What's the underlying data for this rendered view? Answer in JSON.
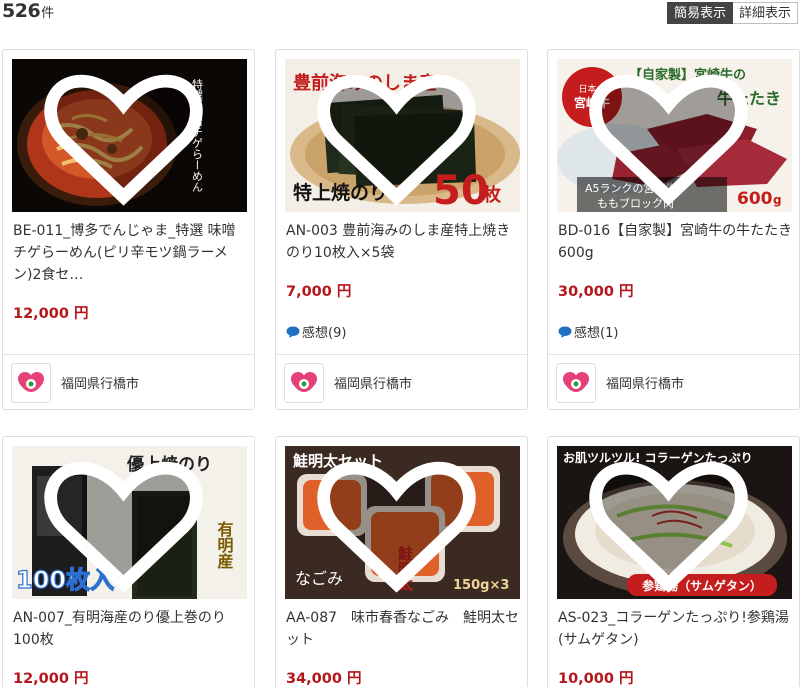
{
  "results": {
    "count": "526",
    "unit": "件"
  },
  "view_toggle": {
    "simple": "簡易表示",
    "detail": "詳細表示"
  },
  "products": [
    {
      "title": "BE-011_博多でんじゃま_特選 味噌チゲらーめん(ピリ辛モツ鍋ラーメン)2食セ…",
      "price": "12,000 円",
      "review": "",
      "city": "福岡県行橋市",
      "photo_text": "特選 味噌チゲらーめん"
    },
    {
      "title": "AN-003 豊前海みのしま産特上焼きのり10枚入×5袋",
      "price": "7,000 円",
      "review": "感想(9)",
      "city": "福岡県行橋市",
      "photo_text_1": "豊前海みのしま産",
      "photo_text_2": "特上焼のり",
      "photo_text_3": "50",
      "photo_text_4": "枚"
    },
    {
      "title": "BD-016【自家製】宮崎牛の牛たたき600g",
      "price": "30,000 円",
      "review": "感想(1)",
      "city": "福岡県行橋市",
      "photo_text_1": "【自家製】宮崎牛の",
      "photo_text_2": "牛たたき",
      "photo_text_3": "日本一",
      "photo_text_4": "宮崎牛",
      "photo_text_5": "A5ランクの宮崎牛",
      "photo_text_6": "ももブロック肉",
      "photo_text_7": "600",
      "photo_text_8": "g"
    },
    {
      "title": "AN-007_有明海産のり優上巻のり100枚",
      "price": "12,000 円",
      "review": "",
      "city": "",
      "photo_text_1": "優上焼のり",
      "photo_text_2": "有明産",
      "photo_text_3": "100枚入"
    },
    {
      "title": "AA-087　味市春香なごみ　鮭明太セット",
      "price": "34,000 円",
      "review": "",
      "city": "",
      "photo_text_1": "鮭明太セット",
      "photo_text_2": "150g×3",
      "photo_text_3": "なごみ",
      "photo_text_4": "鮭明太"
    },
    {
      "title": "AS-023_コラーゲンたっぷり!参鶏湯(サムゲタン)",
      "price": "10,000 円",
      "review": "",
      "city": "",
      "photo_text_1": "お肌ツルツル! コラーゲンたっぷり",
      "photo_text_2": "参鶏湯（サムゲタン）"
    }
  ],
  "colors": {
    "price": "#b4161b",
    "review_icon": "#1f6fc5",
    "toggle_active": "#444444"
  }
}
